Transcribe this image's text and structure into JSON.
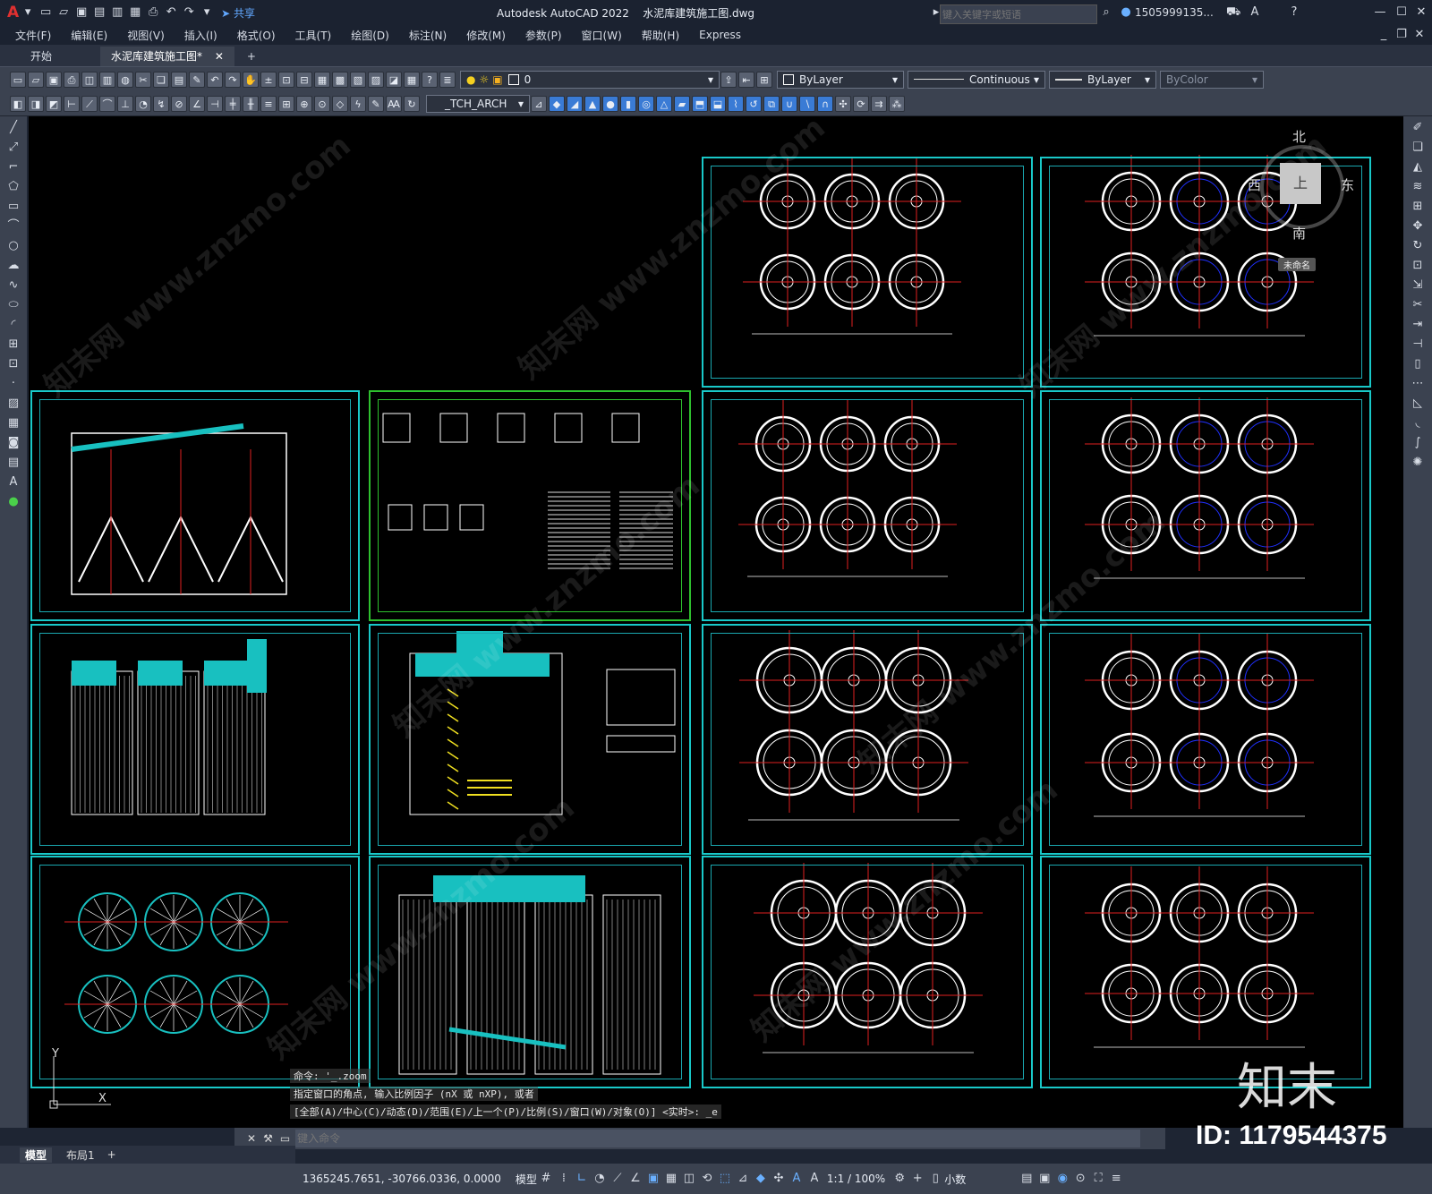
{
  "titlebar": {
    "app_title": "Autodesk AutoCAD 2022",
    "file_title": "水泥库建筑施工图.dwg",
    "share_label": "共享",
    "search_placeholder": "键入关键字或短语",
    "user": "1505999135..."
  },
  "menu": [
    "文件(F)",
    "编辑(E)",
    "视图(V)",
    "插入(I)",
    "格式(O)",
    "工具(T)",
    "绘图(D)",
    "标注(N)",
    "修改(M)",
    "参数(P)",
    "窗口(W)",
    "帮助(H)",
    "Express"
  ],
  "tabs": [
    {
      "label": "开始",
      "active": false
    },
    {
      "label": "水泥库建筑施工图*",
      "active": true
    }
  ],
  "toolbar": {
    "layer": "0",
    "color": "ByLayer",
    "linetype": "Continuous",
    "lineweight": "ByLayer",
    "plotstyle": "ByColor",
    "textstyle": "_TCH_ARCH"
  },
  "viewcube": {
    "north": "北",
    "south": "南",
    "east": "东",
    "west": "西",
    "top": "上",
    "wcs": "未命名"
  },
  "command": {
    "history": [
      "命令: '_.zoom",
      "指定窗口的角点, 输入比例因子 (nX 或 nXP), 或者",
      "[全部(A)/中心(C)/动态(D)/范围(E)/上一个(P)/比例(S)/窗口(W)/对象(O)] <实时>: _e"
    ],
    "placeholder": "键入命令"
  },
  "layout_tabs": [
    "模型",
    "布局1"
  ],
  "status": {
    "coords": "1365245.7651, -30766.0336, 0.0000",
    "space": "模型",
    "scale": "1:1 / 100%",
    "units": "小数"
  },
  "overlay": {
    "brand": "知末",
    "id": "ID: 1179544375",
    "watermark": "知末网 www.znzmo.com"
  },
  "colors": {
    "frame": "#19c8c8",
    "green_frame": "#2ec02e",
    "red": "#e02020",
    "blue": "#2030ff",
    "yellow": "#f0e020",
    "cyan_fill": "#18c0c0"
  }
}
